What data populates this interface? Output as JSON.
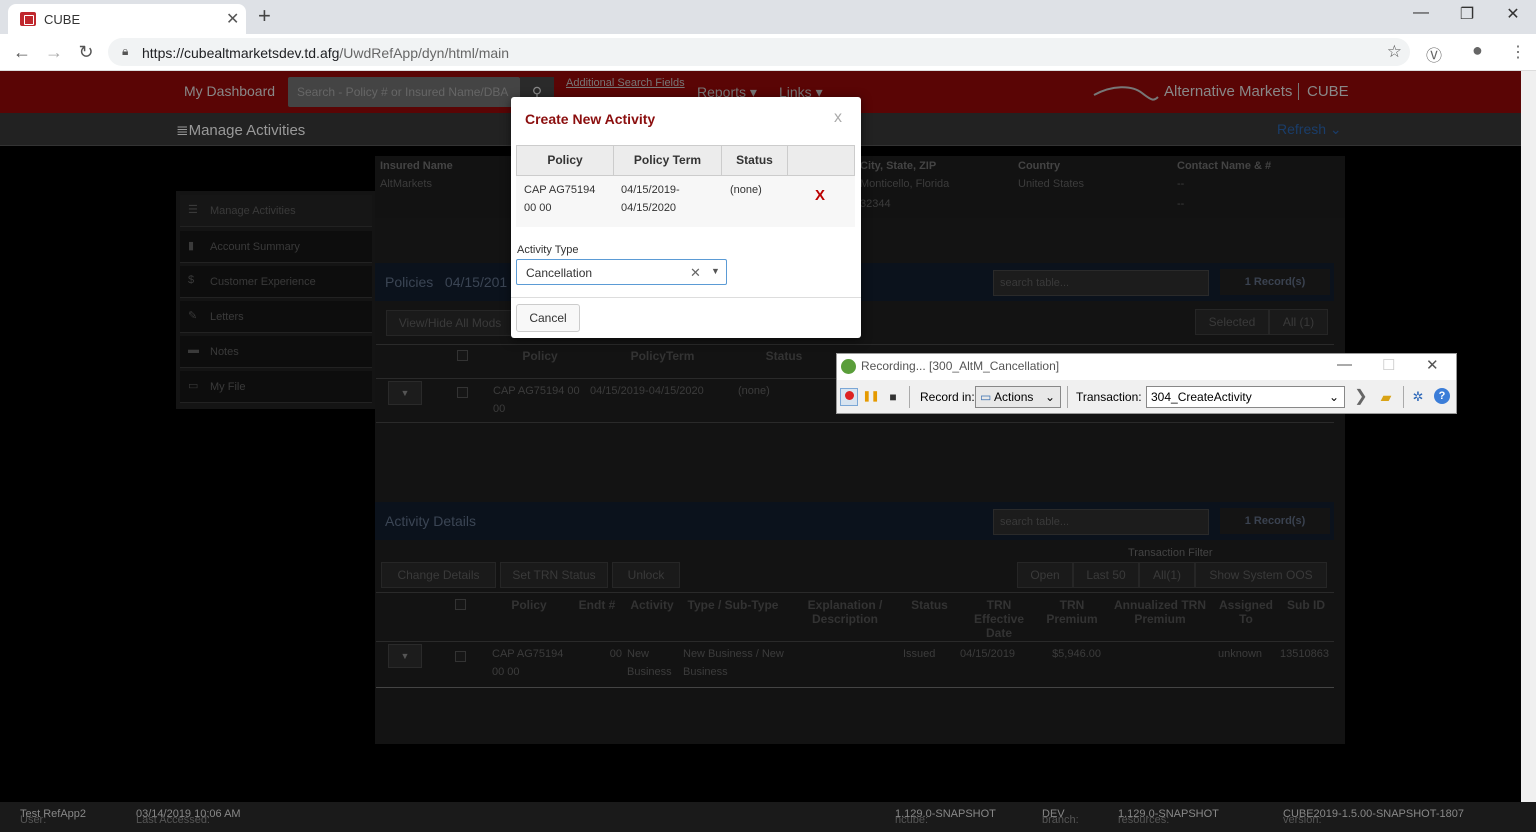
{
  "browser": {
    "tab_title": "CUBE",
    "url_host": "https://cubealtmarketsdev.td.afg",
    "url_path": "/UwdRefApp/dyn/html/main"
  },
  "header": {
    "dashboard": "My Dashboard",
    "search_placeholder": "Search - Policy # or Insured Name/DBA",
    "additional_search": "Additional Search Fields",
    "reports": "Reports ▾",
    "links": "Links ▾",
    "brand": "Alternative Markets",
    "product": "CUBE"
  },
  "subheader": {
    "title": "Manage Activities",
    "refresh": "Refresh"
  },
  "sidebar": {
    "items": [
      {
        "label": "Manage Activities",
        "icon": "list-icon"
      },
      {
        "label": "Account Summary",
        "icon": "document-icon"
      },
      {
        "label": "Customer Experience",
        "icon": "dollar-icon"
      },
      {
        "label": "Letters",
        "icon": "edit-icon"
      },
      {
        "label": "Notes",
        "icon": "comment-icon"
      },
      {
        "label": "My File",
        "icon": "folder-icon"
      }
    ]
  },
  "insured": {
    "headers": [
      "Insured Name",
      "City, State, ZIP",
      "Country",
      "Contact Name & #"
    ],
    "name": "AltMarkets",
    "city": "Monticello, Florida",
    "zip": "32344",
    "country": "United States",
    "contact1": "--",
    "contact2": "--"
  },
  "policies": {
    "title": "Policies",
    "date": "04/15/201",
    "search_placeholder": "search table...",
    "records": "1 Record(s)",
    "view_hide": "View/Hide All Mods",
    "selected": "Selected",
    "all": "All (1)",
    "columns": [
      "Policy",
      "PolicyTerm",
      "Status"
    ],
    "rows": [
      {
        "policy": "CAP AG75194 00 00",
        "term": "04/15/2019-04/15/2020",
        "status": "(none)"
      }
    ]
  },
  "activity": {
    "title": "Activity Details",
    "search_placeholder": "search table...",
    "records": "1 Record(s)",
    "change_details": "Change Details",
    "set_trn_status": "Set TRN Status",
    "unlock": "Unlock",
    "filter_label": "Transaction Filter",
    "filters": [
      "Open",
      "Last 50",
      "All(1)",
      "Show System OOS"
    ],
    "columns": [
      "Policy",
      "Endt #",
      "Activity",
      "Type / Sub-Type",
      "Explanation / Description",
      "Status",
      "TRN Effective Date",
      "TRN Premium",
      "Annualized TRN Premium",
      "Assigned To",
      "Sub ID"
    ],
    "rows": [
      {
        "policy": "CAP AG75194 00 00",
        "endt": "00",
        "activity": "New Business",
        "type": "New Business / New Business",
        "explanation": "",
        "status": "Issued",
        "eff_date": "04/15/2019",
        "premium": "$5,946.00",
        "annualized": "",
        "assigned": "unknown",
        "sub_id": "13510863"
      }
    ]
  },
  "modal": {
    "title": "Create New Activity",
    "close": "x",
    "columns": [
      "Policy",
      "Policy Term",
      "Status"
    ],
    "row": {
      "policy_l1": "CAP AG75194",
      "policy_l2": "00 00",
      "term_l1": "04/15/2019-",
      "term_l2": "04/15/2020",
      "status": "(none)",
      "remove": "X"
    },
    "activity_type_label": "Activity Type",
    "activity_type_value": "Cancellation",
    "cancel": "Cancel"
  },
  "recorder": {
    "title": "Recording... [300_AltM_Cancellation]",
    "record_in_label": "Record in:",
    "record_in_value": "Actions",
    "transaction_label": "Transaction:",
    "transaction_value": "304_CreateActivity"
  },
  "statusbar": {
    "user_label": "User:",
    "user": "Test RefApp2",
    "accessed_label": "Last Accessed:",
    "accessed": "03/14/2019 10:06 AM",
    "ncube_label": "ncube:",
    "ncube": "1.129.0-SNAPSHOT",
    "branch_label": "branch:",
    "branch": "DEV",
    "resources_label": "resources:",
    "resources": "1.129.0-SNAPSHOT",
    "version_label": "version:",
    "version": "CUBE2019-1.5.00-SNAPSHOT-1807"
  }
}
